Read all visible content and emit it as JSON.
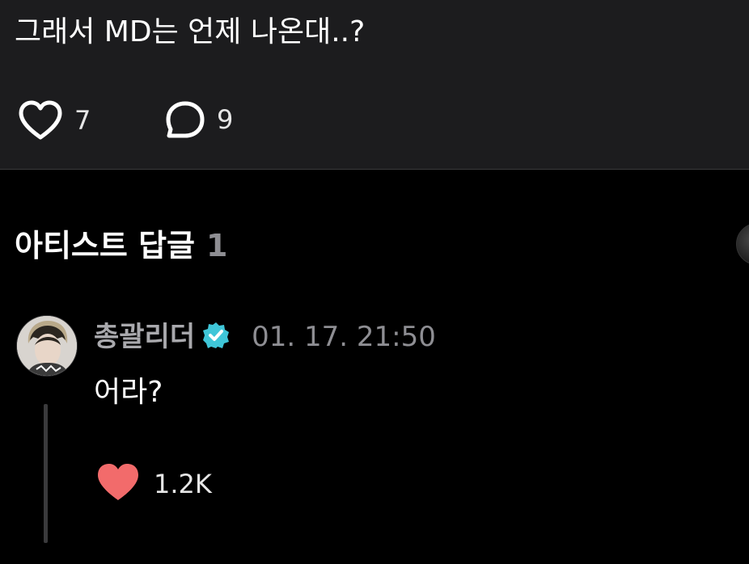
{
  "post": {
    "text": "그래서 MD는 언제 나온대..?",
    "like_count": "7",
    "comment_count": "9"
  },
  "artist_replies": {
    "title": "아티스트 답글",
    "count": "1"
  },
  "reply": {
    "author": "총괄리더",
    "timestamp": "01. 17. 21:50",
    "text": "어라?",
    "like_count": "1.2K"
  },
  "colors": {
    "background": "#000000",
    "card": "#1c1c1e",
    "liked_heart": "#f26b6b",
    "verified_badge": "#3fc6d8",
    "muted_text": "#8e8e93"
  },
  "icons": {
    "like": "heart-outline-icon",
    "comment": "speech-bubble-icon",
    "verified": "verified-badge-icon",
    "reply_like": "heart-filled-icon"
  }
}
